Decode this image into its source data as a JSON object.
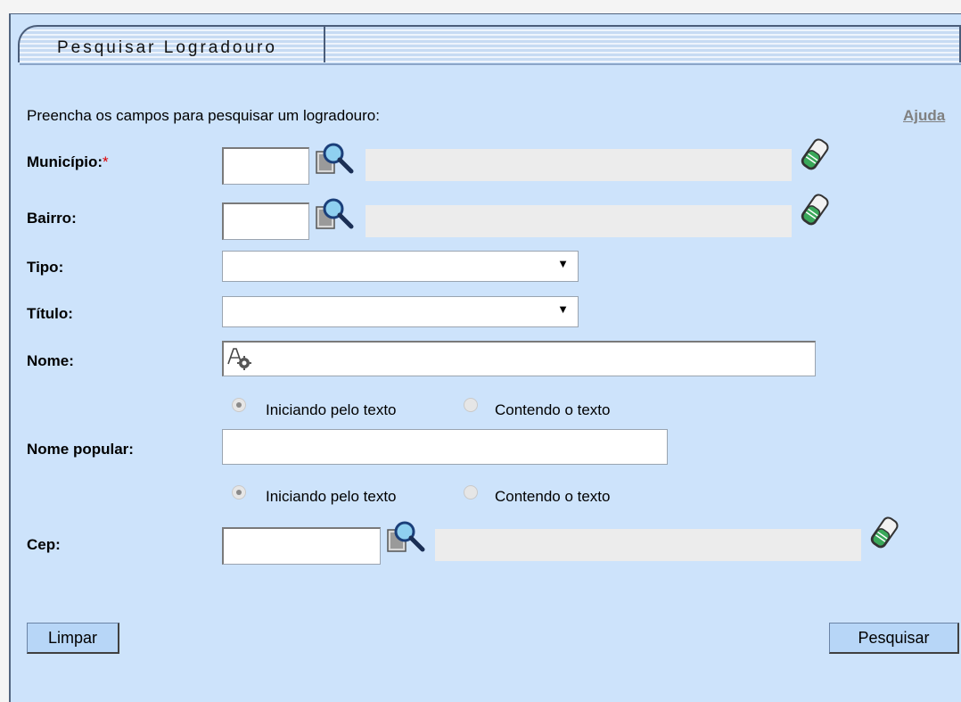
{
  "form": {
    "title": "Pesquisar Logradouro",
    "instruction": "Preencha os campos para pesquisar um logradouro:",
    "help_link": "Ajuda",
    "fields": {
      "municipio": {
        "label": "Município:",
        "required_mark": "*",
        "code_value": "",
        "description": ""
      },
      "bairro": {
        "label": "Bairro:",
        "code_value": "",
        "description": ""
      },
      "tipo": {
        "label": "Tipo:",
        "selected": ""
      },
      "titulo": {
        "label": "Título:",
        "selected": ""
      },
      "nome": {
        "label": "Nome:",
        "value": ""
      },
      "nome_popular": {
        "label": "Nome popular:",
        "value": ""
      },
      "cep": {
        "label": "Cep:",
        "code_value": "",
        "description": ""
      }
    },
    "nome_options": {
      "starting": "Iniciando pelo texto",
      "containing": "Contendo o texto",
      "selected": "starting"
    },
    "nome_popular_options": {
      "starting": "Iniciando pelo texto",
      "containing": "Contendo o texto",
      "selected": "starting"
    },
    "buttons": {
      "clear": "Limpar",
      "search": "Pesquisar"
    }
  },
  "icons": {
    "lookup": "search-icon",
    "eraser": "eraser-icon",
    "autocomplete": "autocomplete-icon",
    "dropdown": "chevron-down-icon"
  },
  "colors": {
    "panel_bg": "#cde3fb",
    "button_bg": "#b7d6f7",
    "required": "#dd0000",
    "help_link": "#808080"
  }
}
